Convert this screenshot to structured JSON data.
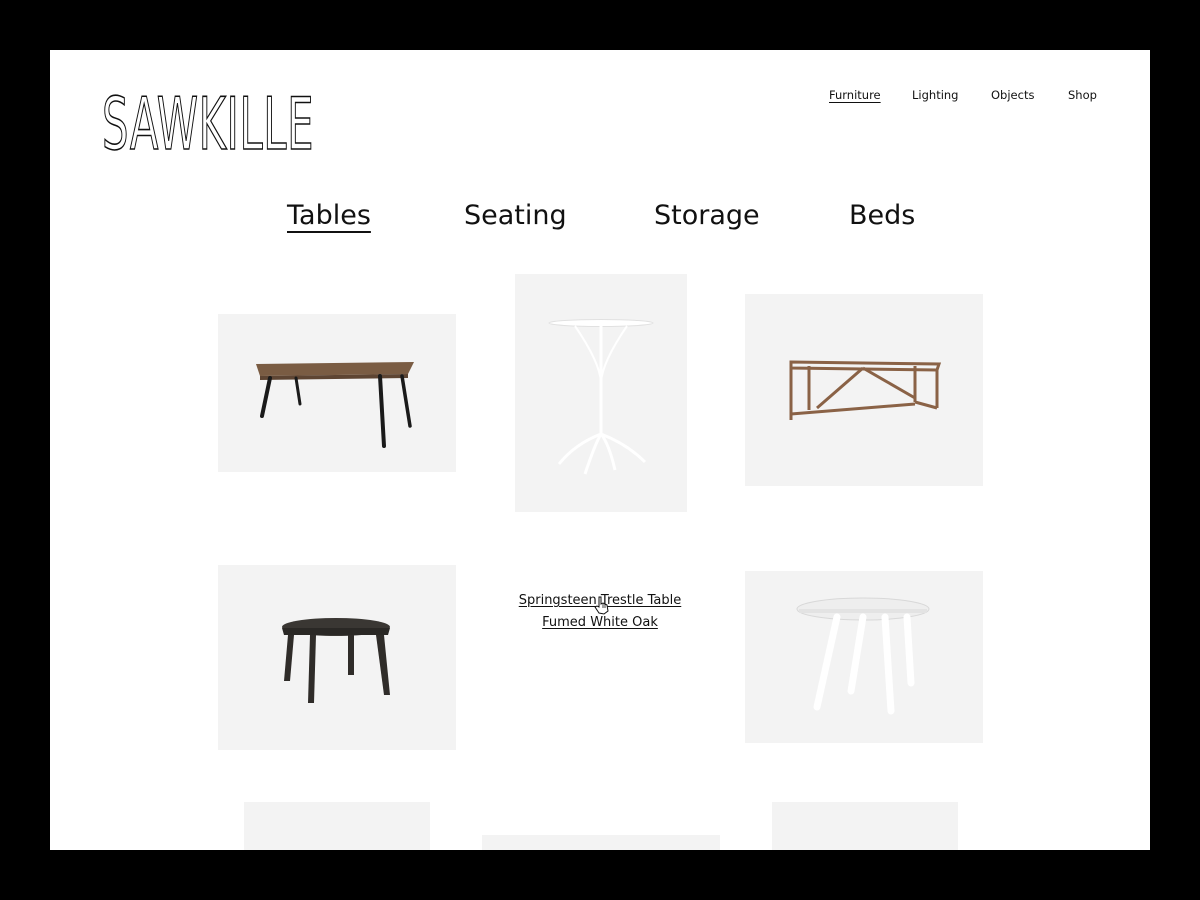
{
  "brand": {
    "logo_text": "SAWKILLE"
  },
  "nav": {
    "items": [
      {
        "label": "Furniture",
        "active": true
      },
      {
        "label": "Lighting",
        "active": false
      },
      {
        "label": "Objects",
        "active": false
      },
      {
        "label": "Shop",
        "active": false
      }
    ]
  },
  "categories": {
    "items": [
      {
        "label": "Tables",
        "active": true
      },
      {
        "label": "Seating",
        "active": false
      },
      {
        "label": "Storage",
        "active": false
      },
      {
        "label": "Beds",
        "active": false
      }
    ]
  },
  "hover_product": {
    "name": "Springsteen Trestle Table",
    "finish": "Fumed White Oak"
  },
  "products": [
    {
      "icon": "wood-dining-table-image"
    },
    {
      "icon": "white-bistro-table-image"
    },
    {
      "icon": "walnut-frame-table-image"
    },
    {
      "icon": "dark-round-table-image"
    },
    {
      "icon": "springsteen-trestle-table-image"
    },
    {
      "icon": "white-round-table-image"
    },
    {
      "icon": "product-image"
    },
    {
      "icon": "product-image"
    },
    {
      "icon": "product-image"
    }
  ],
  "colors": {
    "background": "#000000",
    "page": "#ffffff",
    "card": "#f3f3f3",
    "text": "#111111",
    "wood": "#7a5c43",
    "walnut": "#8a6246"
  }
}
